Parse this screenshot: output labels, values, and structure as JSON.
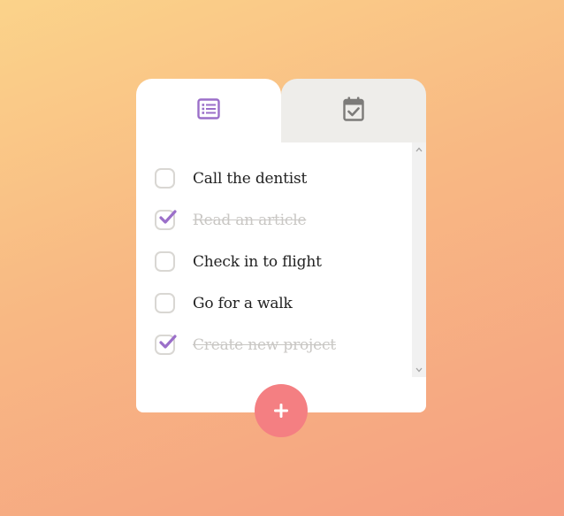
{
  "tabs": [
    {
      "name": "list",
      "icon": "list-icon",
      "active": true
    },
    {
      "name": "calendar",
      "icon": "calendar-check-icon",
      "active": false
    }
  ],
  "todos": [
    {
      "label": "Call the dentist",
      "done": false
    },
    {
      "label": "Read an article",
      "done": true
    },
    {
      "label": "Check in to flight",
      "done": false
    },
    {
      "label": "Go for a walk",
      "done": false
    },
    {
      "label": "Create new project",
      "done": true
    }
  ],
  "fab": {
    "icon": "plus-icon"
  },
  "colors": {
    "accent": "#9b6fc9",
    "fab": "#f47f82",
    "inactive_tab": "#eeedea",
    "icon_gray": "#7c7b79",
    "done_text": "#c9c7c4"
  }
}
